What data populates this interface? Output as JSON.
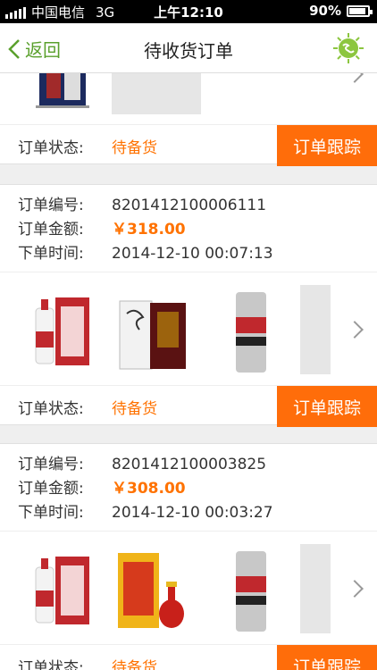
{
  "status_bar": {
    "carrier": "中国电信",
    "network": "3G",
    "time": "上午12:10",
    "battery": "90%",
    "battery_level": 0.9
  },
  "nav": {
    "back_label": "返回",
    "title": "待收货订单"
  },
  "labels": {
    "order_no": "订单编号:",
    "amount": "订单金额:",
    "order_time": "下单时间:",
    "status": "订单状态:",
    "track_button": "订单跟踪"
  },
  "orders": [
    {
      "status": "待备货"
    },
    {
      "order_no": "8201412100006111",
      "amount": "￥318.00",
      "time": "2014-12-10 00:07:13",
      "status": "待备货"
    },
    {
      "order_no": "8201412100003825",
      "amount": "￥308.00",
      "time": "2014-12-10 00:03:27",
      "status": "待备货"
    }
  ]
}
